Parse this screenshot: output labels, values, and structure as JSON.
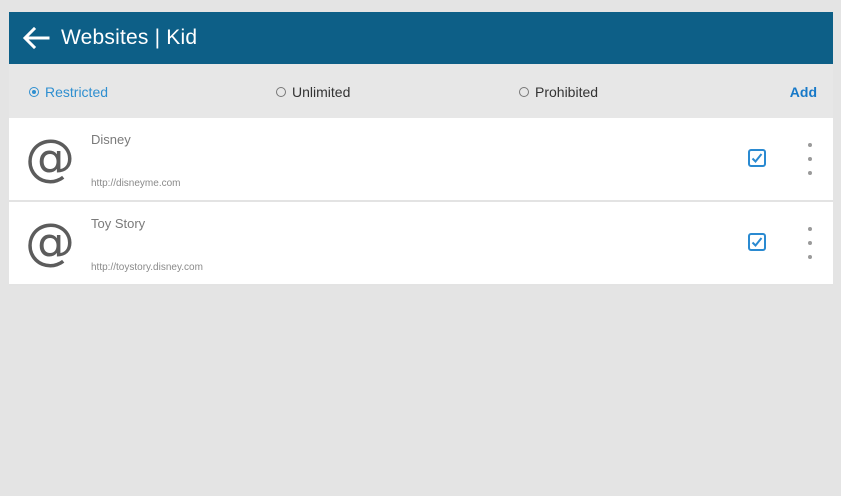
{
  "header": {
    "title": "Websites | Kid",
    "back_icon": "arrow-left-icon"
  },
  "filters": {
    "options": [
      {
        "label": "Restricted",
        "selected": true
      },
      {
        "label": "Unlimited",
        "selected": false
      },
      {
        "label": "Prohibited",
        "selected": false
      }
    ],
    "add_label": "Add"
  },
  "websites": [
    {
      "icon": "@",
      "name": "Disney",
      "url": "http://disneyme.com",
      "checked": true
    },
    {
      "icon": "@",
      "name": "Toy Story",
      "url": "http://toystory.disney.com",
      "checked": true
    }
  ],
  "colors": {
    "appbar": "#0d5f87",
    "accent": "#2f8fd0",
    "background": "#e4e4e4"
  }
}
